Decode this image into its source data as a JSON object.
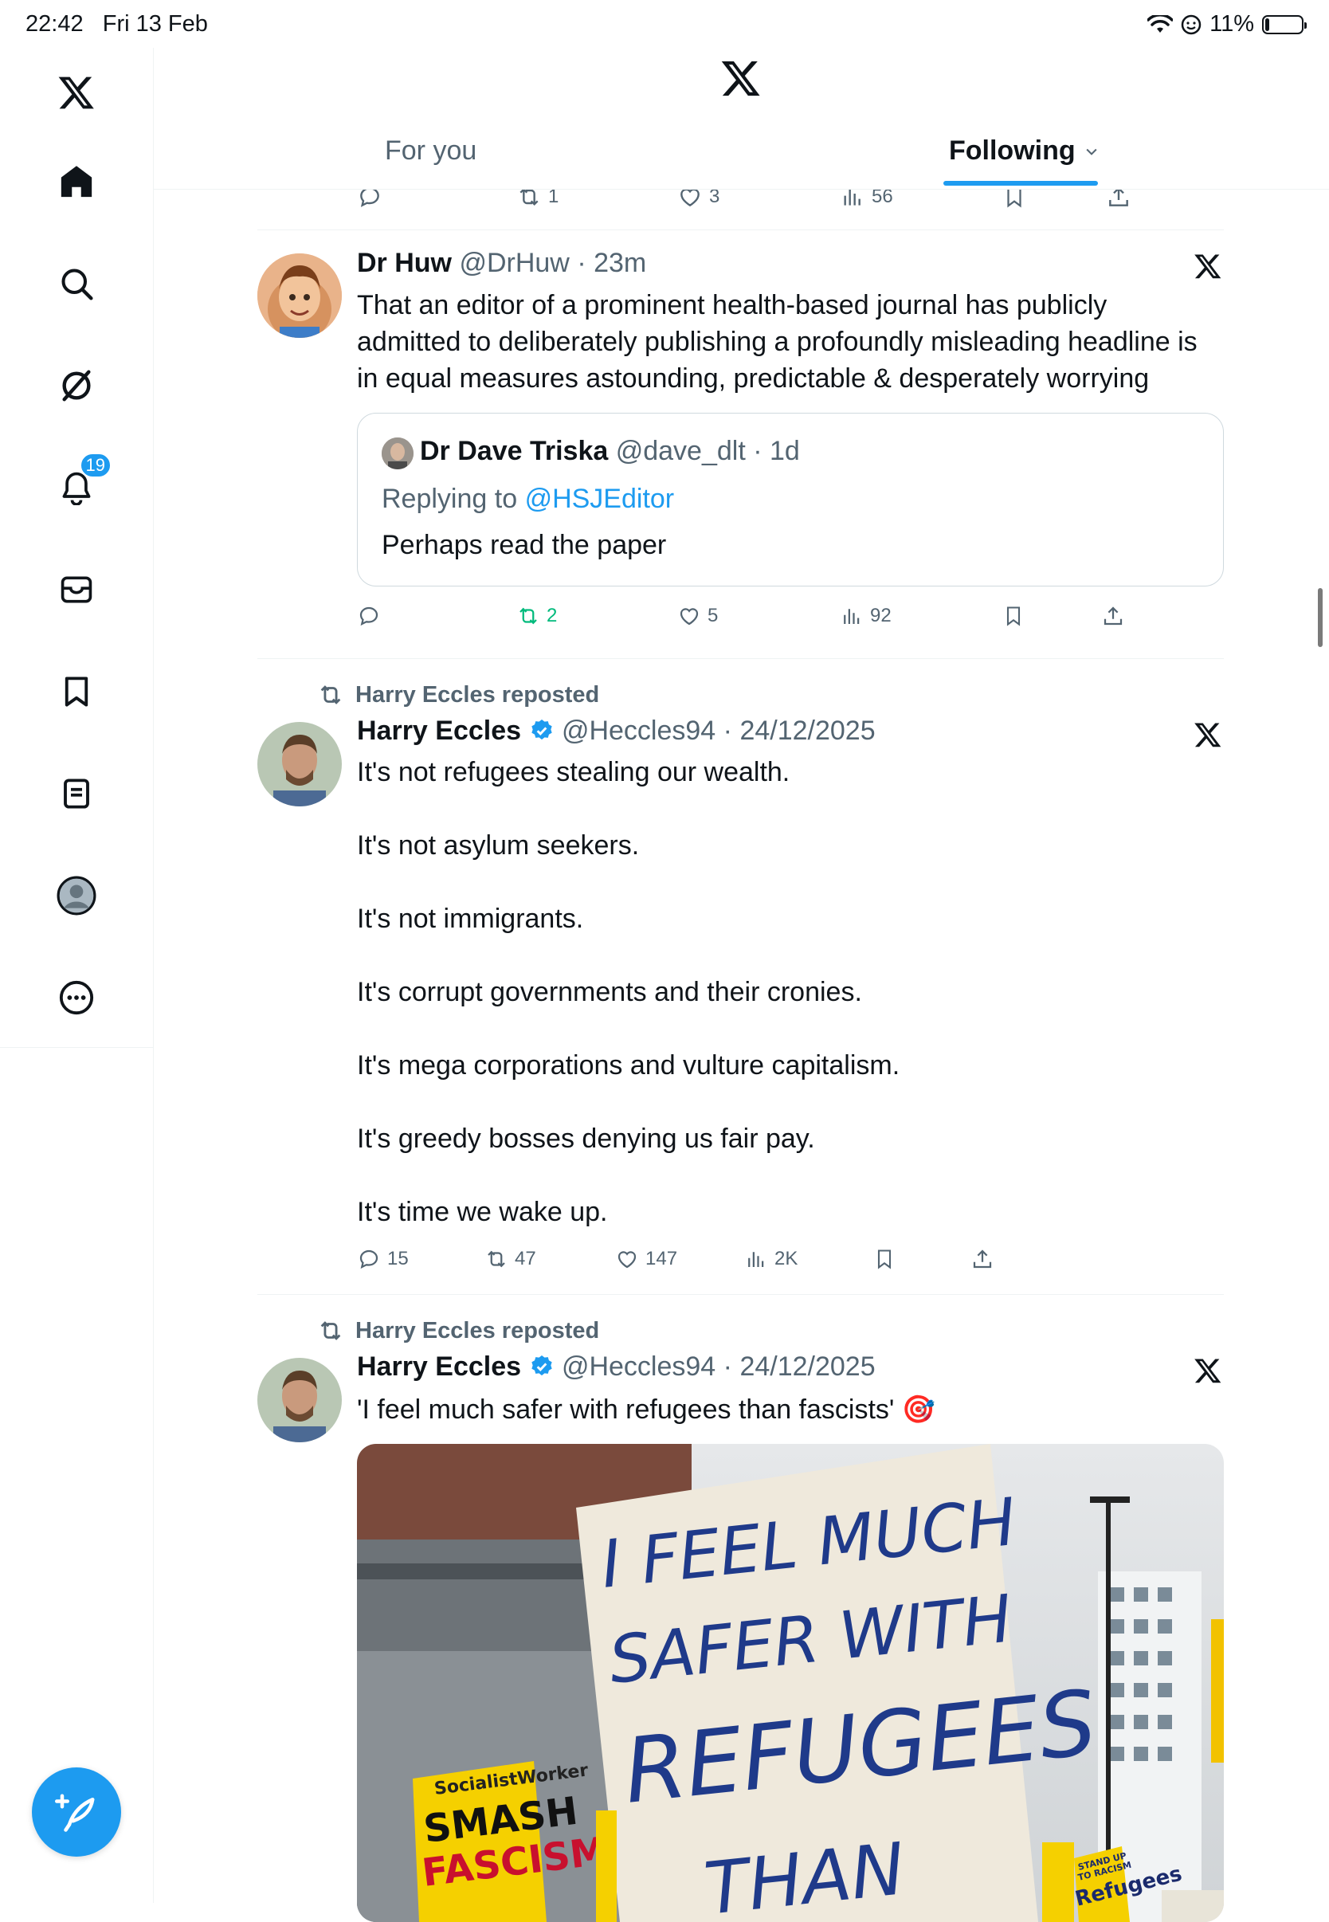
{
  "status_bar": {
    "time": "22:42",
    "date": "Fri 13 Feb",
    "battery": "11%",
    "battery_level": 0.11
  },
  "sidebar": {
    "notification_count": "19",
    "items": [
      "home-icon",
      "search-icon",
      "grok-icon",
      "notifications-icon",
      "messages-icon",
      "bookmarks-icon",
      "lists-icon",
      "profile-icon",
      "more-icon"
    ]
  },
  "header": {
    "tabs": [
      {
        "label": "For you"
      },
      {
        "label": "Following"
      }
    ]
  },
  "colors": {
    "accent": "#1d9bf0",
    "text": "#0f1419",
    "muted": "#536471",
    "repost_green": "#00ba7c"
  },
  "top_actions": {
    "reposts": "1",
    "likes": "3",
    "views": "56"
  },
  "tweets": [
    {
      "name": "Dr Huw",
      "handle": "@DrHuw",
      "time": "23m",
      "text_lines": [
        "That an editor of a prominent health-based journal has publicly",
        "admitted to deliberately publishing a profoundly misleading headline is",
        "in equal measures astounding, predictable & desperately worrying"
      ],
      "quote": {
        "name": "Dr Dave Triska",
        "handle": "@dave_dlt",
        "time": "1d",
        "replying_prefix": "Replying to",
        "replying_to": "@HSJEditor",
        "text": "Perhaps read the paper"
      },
      "reposts": "2",
      "likes": "5",
      "views": "92"
    },
    {
      "repost_label": "Harry Eccles reposted",
      "name": "Harry Eccles",
      "handle": "@Heccles94",
      "time": "24/12/2025",
      "paragraphs": [
        "It's not refugees stealing our wealth.",
        "It's not asylum seekers.",
        "It's not immigrants.",
        "It's corrupt governments and their cronies.",
        "It's mega corporations and vulture capitalism.",
        "It's greedy bosses denying us fair pay.",
        "It's time we wake up."
      ],
      "replies": "15",
      "reposts": "47",
      "likes": "147",
      "views": "2K"
    },
    {
      "repost_label": "Harry Eccles reposted",
      "name": "Harry Eccles",
      "handle": "@Heccles94",
      "time": "24/12/2025",
      "text": "'I feel much safer with refugees than fascists'",
      "emoji": "🎯",
      "image": {
        "sign_lines": [
          "I FEEL MUCH",
          "SAFER WITH",
          "REFUGEES",
          "THAN"
        ],
        "placard_top": "SocialistWorker",
        "placard_main": [
          "SMASH",
          "FASCISM"
        ],
        "small_placard": [
          "STAND UP",
          "TO RACISM",
          "Refugees"
        ]
      }
    }
  ]
}
